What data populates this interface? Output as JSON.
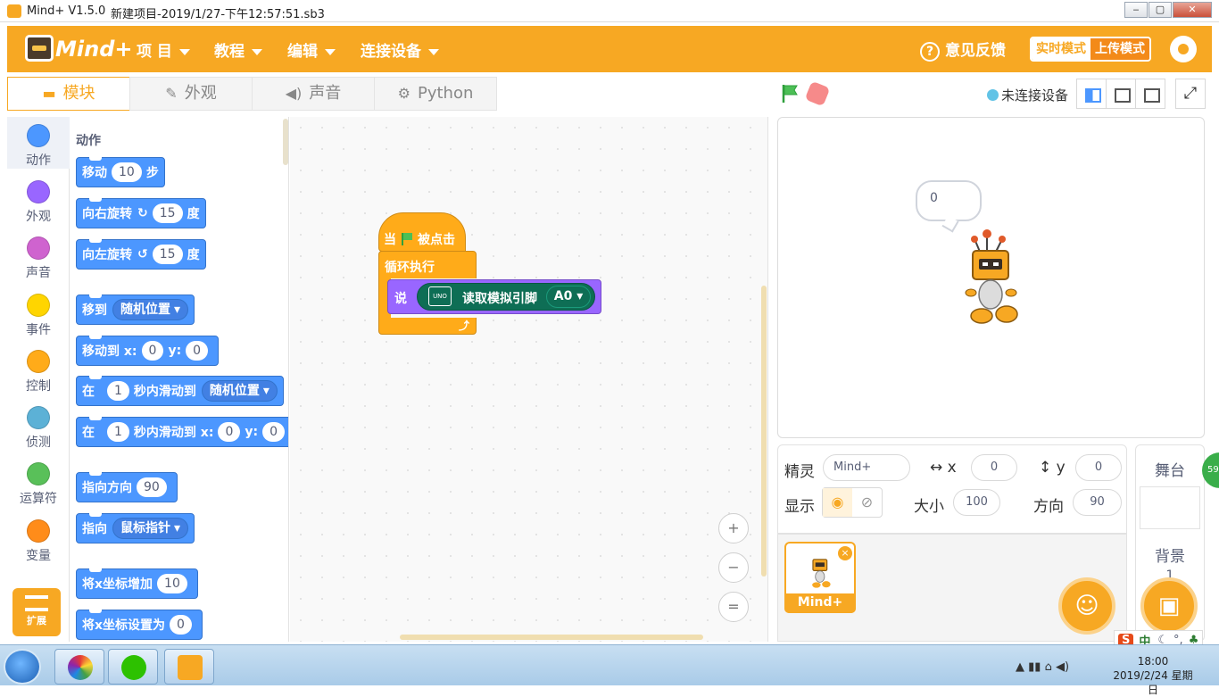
{
  "window": {
    "title": "Mind+ V1.5.0",
    "file": "新建项目-2019/1/27-下午12:57:51.sb3",
    "controls": [
      "‒",
      "▢",
      "✕"
    ]
  },
  "menubar": {
    "logo": "Mind+",
    "menus": [
      "项 目",
      "教程",
      "编辑",
      "连接设备"
    ],
    "feedback": "意见反馈",
    "mode_live": "实时模式",
    "mode_upload": "上传模式",
    "accent": "#f7a823"
  },
  "tabs": [
    {
      "label": "模块",
      "icon": "blocks-icon"
    },
    {
      "label": "外观",
      "icon": "brush-icon"
    },
    {
      "label": "声音",
      "icon": "speaker-icon"
    },
    {
      "label": "Python",
      "icon": "python-icon"
    }
  ],
  "stage_controls": {
    "connection": "未连接设备"
  },
  "categories": [
    {
      "label": "动作",
      "color": "#4c97ff"
    },
    {
      "label": "外观",
      "color": "#9966ff"
    },
    {
      "label": "声音",
      "color": "#cf63cf"
    },
    {
      "label": "事件",
      "color": "#ffd500"
    },
    {
      "label": "控制",
      "color": "#ffab19"
    },
    {
      "label": "侦测",
      "color": "#5cb1d6"
    },
    {
      "label": "运算符",
      "color": "#59c059"
    },
    {
      "label": "变量",
      "color": "#ff8c1a"
    }
  ],
  "extensions_label": "扩展",
  "palette": {
    "title": "动作",
    "blocks": {
      "move": {
        "label": "移动",
        "value": "10",
        "suffix": "步"
      },
      "turn_right": {
        "label": "向右旋转",
        "icon": "↻",
        "value": "15",
        "suffix": "度"
      },
      "turn_left": {
        "label": "向左旋转",
        "icon": "↺",
        "value": "15",
        "suffix": "度"
      },
      "goto": {
        "label": "移到",
        "option": "随机位置"
      },
      "goto_xy": {
        "label": "移动到 x:",
        "x": "0",
        "ylabel": "y:",
        "y": "0"
      },
      "glide": {
        "label": "在",
        "value": "1",
        "mid": "秒内滑动到",
        "option": "随机位置"
      },
      "glide_xy": {
        "label": "在",
        "value": "1",
        "mid": "秒内滑动到 x:",
        "x": "0",
        "ylabel": "y:",
        "y": "0"
      },
      "point_dir": {
        "label": "指向方向",
        "value": "90"
      },
      "point_to": {
        "label": "指向",
        "option": "鼠标指针"
      },
      "change_x": {
        "label": "将x坐标增加",
        "value": "10"
      },
      "set_x": {
        "label": "将x坐标设置为",
        "value": "0"
      }
    }
  },
  "script": {
    "hat_prefix": "当",
    "hat_suffix": "被点击",
    "loop": "循环执行",
    "say": "说",
    "board_badge": "UNO",
    "reporter": "读取模拟引脚",
    "pin": "A0",
    "loop_arrow": "⤴"
  },
  "zoom": {
    "in": "+",
    "out": "−",
    "reset": "="
  },
  "stage": {
    "bubble": "0"
  },
  "sprite_info": {
    "sprite_label": "精灵",
    "sprite_name": "Mind+",
    "x_label": "x",
    "x": "0",
    "y_label": "y",
    "y": "0",
    "show_label": "显示",
    "size_label": "大小",
    "size": "100",
    "direction_label": "方向",
    "direction": "90"
  },
  "sprites": [
    {
      "name": "Mind+"
    }
  ],
  "stage_panel": {
    "title": "舞台",
    "backdrop_label": "背景",
    "backdrop_count": "1"
  },
  "side_badge": "59",
  "taskbar": {
    "time": "18:00",
    "date": "2019/2/24 星期日"
  },
  "ime": {
    "brand": "S",
    "mode": "中"
  }
}
